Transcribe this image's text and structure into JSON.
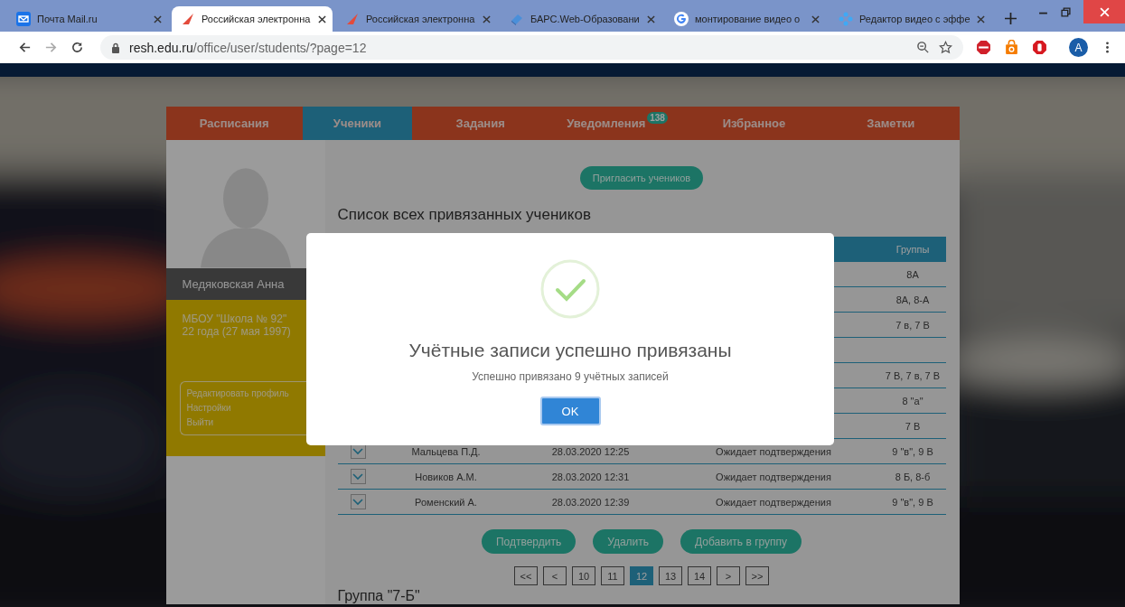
{
  "browser": {
    "tabs": [
      {
        "title": "Почта Mail.ru",
        "selected": false
      },
      {
        "title": "Российская электронна",
        "selected": true
      },
      {
        "title": "Российская электронна",
        "selected": false
      },
      {
        "title": "БАРС.Web-Образовани",
        "selected": false
      },
      {
        "title": "монтирование видео о",
        "selected": false
      },
      {
        "title": "Редактор видео с эффе",
        "selected": false
      }
    ],
    "address": {
      "host": "resh.edu.ru",
      "path": "/office/user/students/?page=12"
    },
    "avatar": "A"
  },
  "nav": [
    {
      "label": "Расписания",
      "selected": false
    },
    {
      "label": "Ученики",
      "selected": true
    },
    {
      "label": "Задания",
      "selected": false
    },
    {
      "label": "Уведомления",
      "selected": false,
      "badge": "138"
    },
    {
      "label": "Избранное",
      "selected": false
    },
    {
      "label": "Заметки",
      "selected": false
    }
  ],
  "profile": {
    "name": "Медяковская Анна",
    "school": "МБОУ \"Школа № 92\"",
    "age": "22 года (27 мая 1997)",
    "links": [
      "Редактировать профиль",
      "Настройки",
      "Выйти"
    ]
  },
  "invite_button": "Пригласить учеников",
  "heading": "Список всех привязанных учеников",
  "table": {
    "columns": [
      {},
      {},
      {},
      {},
      {
        "label": "Группы"
      }
    ],
    "rows": [
      {
        "group": "8А"
      },
      {
        "group": "8А, 8-А"
      },
      {
        "group": "7 в, 7 В"
      },
      {},
      {
        "group": "7 В, 7 в, 7 В"
      },
      {
        "group": "8 \"а\""
      },
      {
        "group": "7 В"
      },
      {
        "checked": true,
        "name": "Мальцева П.Д.",
        "date": "28.03.2020 12:25",
        "status": "Ожидает подтверждения",
        "group": "9 \"в\", 9 В"
      },
      {
        "checked": true,
        "name": "Новиков А.М.",
        "date": "28.03.2020 12:31",
        "status": "Ожидает подтверждения",
        "group": "8 Б, 8-б"
      },
      {
        "checked": true,
        "name": "Роменский А.",
        "date": "28.03.2020 12:39",
        "status": "Ожидает подтверждения",
        "group": "9 \"в\", 9 В"
      }
    ]
  },
  "actions": [
    "Подтвердить",
    "Удалить",
    "Добавить в группу"
  ],
  "pagination": [
    {
      "label": "<<",
      "selected": false
    },
    {
      "label": "<",
      "selected": false
    },
    {
      "label": "10",
      "selected": false
    },
    {
      "label": "11",
      "selected": false
    },
    {
      "label": "12",
      "selected": true
    },
    {
      "label": "13",
      "selected": false
    },
    {
      "label": "14",
      "selected": false
    },
    {
      "label": ">",
      "selected": false
    },
    {
      "label": ">>",
      "selected": false
    }
  ],
  "next_group": "Группа \"7-Б\"",
  "dialog": {
    "title": "Учётные записи успешно привязаны",
    "message": "Успешно привязано 9 учётных записей",
    "button": "OK"
  }
}
